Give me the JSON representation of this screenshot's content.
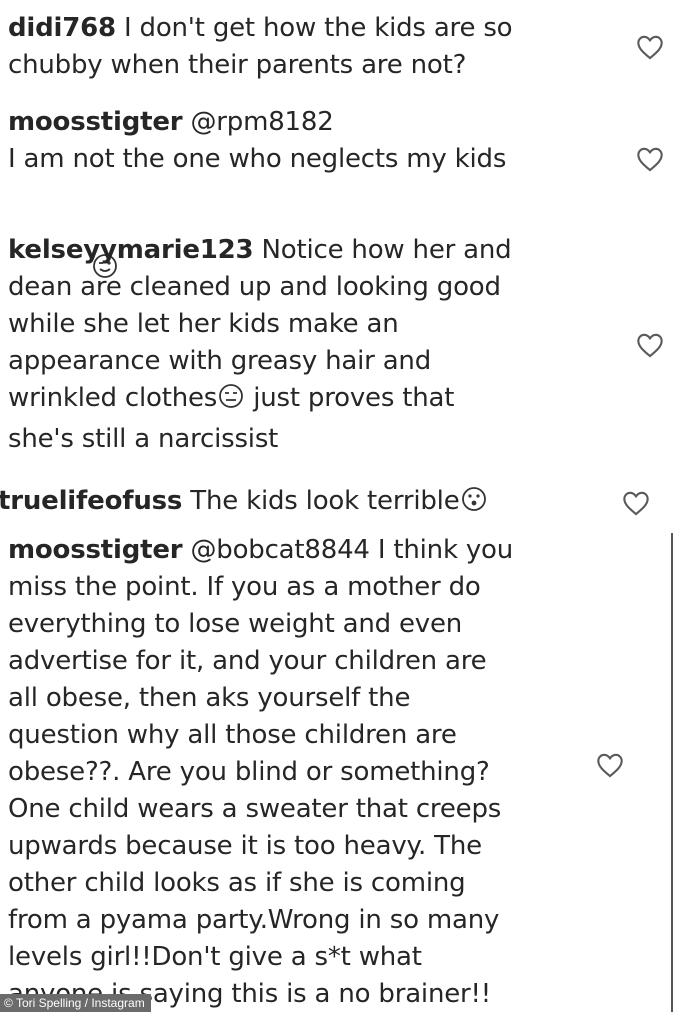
{
  "comments": [
    {
      "username": "didi768",
      "lines": [
        " I don't get how the kids are so",
        "chubby when their parents are not?"
      ]
    },
    {
      "username": "moosstigter",
      "lines": [
        " @rpm8182",
        "I am not the one who neglects my kids"
      ],
      "emoji": "wink-face-icon"
    },
    {
      "username": "kelseyymarie123",
      "lines": [
        " Notice how her and",
        "dean are cleaned up and looking good",
        "while she let her kids make an",
        "appearance with greasy hair and",
        "wrinkled clothes",
        " just proves that",
        "she's still a narcissist"
      ],
      "emoji": "expressionless-face-icon"
    },
    {
      "username": "truelifeofuss",
      "lines": [
        " The kids look terrible"
      ],
      "emoji": "surprised-face-icon"
    },
    {
      "username": "moosstigter",
      "lines": [
        " @bobcat8844 I think you",
        "miss the point. If you as a mother do",
        "everything to lose weight and even",
        "advertise for it, and your children are",
        "all obese, then aks yourself the",
        "question why all those children are",
        "obese??. Are you blind or something?",
        "One child wears a sweater that creeps",
        "upwards because it is too heavy. The",
        "other child looks as if she is coming",
        "from a pyama party.Wrong in so many",
        "levels girl!!Don't give a s*t what",
        "anyone is saying this is a no brainer!!"
      ]
    }
  ],
  "like_icon": "heart-outline-icon",
  "credit": "© Tori Spelling / Instagram"
}
